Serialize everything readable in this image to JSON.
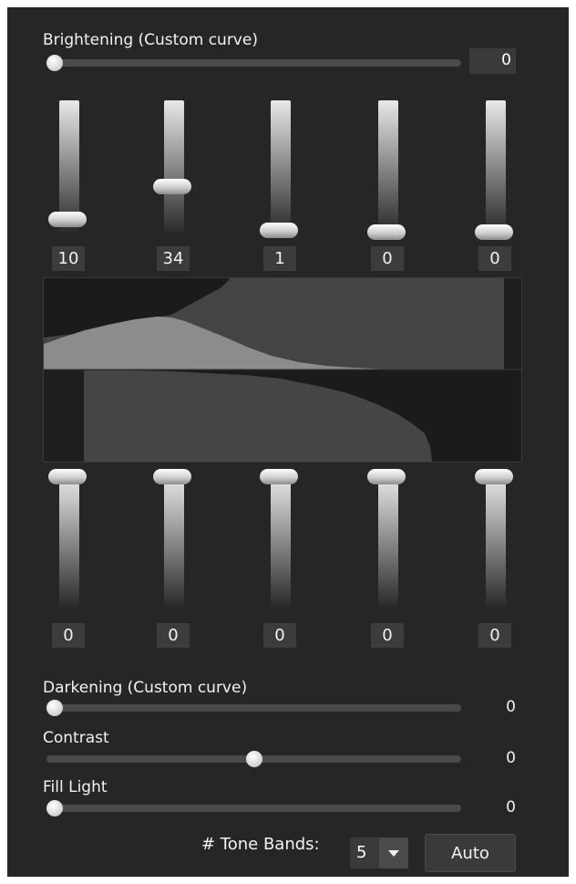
{
  "brightening": {
    "label": "Brightening (Custom curve)",
    "value": "0",
    "level": 0
  },
  "bright_bands": [
    {
      "value": "10",
      "level": 0.1
    },
    {
      "value": "34",
      "level": 0.34
    },
    {
      "value": "1",
      "level": 0.01
    },
    {
      "value": "0",
      "level": 0
    },
    {
      "value": "0",
      "level": 0
    }
  ],
  "dark_bands": [
    {
      "value": "0",
      "level": 0
    },
    {
      "value": "0",
      "level": 0
    },
    {
      "value": "0",
      "level": 0
    },
    {
      "value": "0",
      "level": 0
    },
    {
      "value": "0",
      "level": 0
    }
  ],
  "darkening": {
    "label": "Darkening (Custom curve)",
    "value": "0",
    "level": 0
  },
  "contrast": {
    "label": "Contrast",
    "value": "0",
    "level": 0.5
  },
  "fill_light": {
    "label": "Fill Light",
    "value": "0",
    "level": 0
  },
  "tone_bands": {
    "label": "# Tone Bands:",
    "value": "5",
    "arrow_icon": "dropdown-arrow-icon"
  },
  "auto_button": {
    "label": "Auto"
  },
  "colors": {
    "panel": "#262626",
    "track": "#4a4a4a",
    "histogram_light": "#8a8a8a",
    "histogram_dark": "#444444"
  }
}
